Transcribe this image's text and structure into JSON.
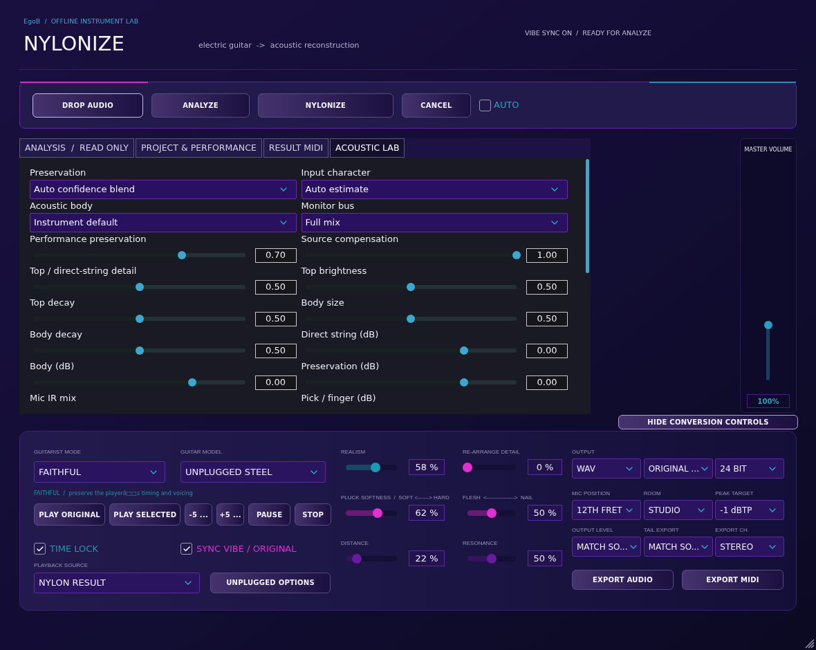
{
  "header": {
    "breadcrumb": "EgoB  /  OFFLINE INSTRUMENT LAB",
    "title": "NYLONIZE",
    "subtitle": "electric guitar  ->  acoustic reconstruction",
    "status": "VIBE SYNC ON  /  READY FOR ANALYZE"
  },
  "toolbar": {
    "buttons": [
      {
        "label": "DROP AUDIO",
        "selected": true
      },
      {
        "label": "ANALYZE",
        "selected": false
      },
      {
        "label": "NYLONIZE",
        "selected": false
      },
      {
        "label": "CANCEL",
        "selected": false
      }
    ],
    "auto": {
      "label": "AUTO",
      "checked": false
    }
  },
  "tabs": [
    {
      "label": "ANALYSIS  /  READ ONLY",
      "selected": false
    },
    {
      "label": "PROJECT & PERFORMANCE",
      "selected": false
    },
    {
      "label": "RESULT MIDI",
      "selected": false
    },
    {
      "label": "ACOUSTIC LAB",
      "selected": true
    }
  ],
  "acoustic_lab": {
    "columns": [
      [
        {
          "kind": "dropdown",
          "label": "Preservation",
          "value": "Auto confidence blend"
        },
        {
          "kind": "dropdown",
          "label": "Acoustic body",
          "value": "Instrument default"
        },
        {
          "kind": "slider",
          "label": "Performance preservation",
          "level": 0.7,
          "reading": "0.70"
        },
        {
          "kind": "slider",
          "label": "Top / direct-string detail",
          "level": 0.5,
          "reading": "0.50"
        },
        {
          "kind": "slider",
          "label": "Top decay",
          "level": 0.5,
          "reading": "0.50"
        },
        {
          "kind": "slider",
          "label": "Body decay",
          "level": 0.5,
          "reading": "0.50"
        },
        {
          "kind": "slider",
          "label": "Body (dB)",
          "level": 0.75,
          "reading": "0.00"
        },
        {
          "kind": "label",
          "label": "Mic IR mix"
        }
      ],
      [
        {
          "kind": "dropdown",
          "label": "Input character",
          "value": "Auto estimate"
        },
        {
          "kind": "dropdown",
          "label": "Monitor bus",
          "value": "Full mix"
        },
        {
          "kind": "slider",
          "label": "Source compensation",
          "level": 1,
          "reading": "1.00"
        },
        {
          "kind": "slider",
          "label": "Top brightness",
          "level": 0.5,
          "reading": "0.50"
        },
        {
          "kind": "slider",
          "label": "Body size",
          "level": 0.5,
          "reading": "0.50"
        },
        {
          "kind": "slider",
          "label": "Direct string (dB)",
          "level": 0.75,
          "reading": "0.00"
        },
        {
          "kind": "slider",
          "label": "Preservation (dB)",
          "level": 0.75,
          "reading": "0.00"
        },
        {
          "kind": "label",
          "label": "Pick / finger (dB)"
        }
      ]
    ]
  },
  "master_volume": {
    "title": "MASTER VOLUME",
    "level": 1,
    "reading": "100%"
  },
  "hide_button": {
    "label": "HIDE CONVERSION CONTROLS"
  },
  "conversion": {
    "modes": [
      {
        "label": "GUITARIST MODE",
        "value": "FAITHFUL"
      },
      {
        "label": "GUITAR MODEL",
        "value": "UNPLUGGED STEEL"
      }
    ],
    "hint": "FAITHFUL  /  preserve the playerâ□□s timing and voicing",
    "transport": [
      "PLAY ORIGINAL",
      "PLAY SELECTED",
      "-5 ...",
      "+5 ...",
      "PAUSE",
      "STOP"
    ],
    "toggles": [
      {
        "label": "TIME LOCK",
        "checked": true,
        "color": "#1a9bb0"
      },
      {
        "label": "SYNC VIBE / ORIGINAL",
        "checked": true,
        "color": "#e030d0"
      }
    ],
    "playback_source": {
      "label": "PLAYBACK SOURCE",
      "value": "NYLON RESULT"
    },
    "options_button": "UNPLUGGED OPTIONS",
    "sliders": [
      {
        "label": "REALISM",
        "level": 0.58,
        "reading": "58 %",
        "color": "#1a9bb0"
      },
      {
        "label": "RE-ARRANGE DETAIL",
        "level": 0,
        "reading": "0 %",
        "color": "#e030d0"
      },
      {
        "label": "PLUCK SOFTNESS  /  SOFT <------> HARD",
        "level": 0.62,
        "reading": "62 %",
        "color": "#e030d0"
      },
      {
        "label": "FLESH  <--------------->  NAIL",
        "level": 0.5,
        "reading": "50 %",
        "color": "#e030d0"
      },
      {
        "label": "DISTANCE",
        "level": 0.22,
        "reading": "22 %",
        "color": "#6a1aa0"
      },
      {
        "label": "RESONANCE",
        "level": 0.5,
        "reading": "50 %",
        "color": "#6a1aa0"
      }
    ],
    "output": [
      {
        "label": "OUTPUT",
        "value": "WAV"
      },
      {
        "value": "ORIGINAL ..."
      },
      {
        "value": "24 BIT"
      },
      {
        "label": "MIC POSITION",
        "value": "12TH FRET"
      },
      {
        "label": "ROOM",
        "value": "STUDIO"
      },
      {
        "label": "PEAK TARGET",
        "value": "-1 dBTP"
      },
      {
        "label": "OUTPUT LEVEL",
        "value": "MATCH SO..."
      },
      {
        "label": "TAIL EXPORT",
        "value": "MATCH SO..."
      },
      {
        "label": "EXPORT CH.",
        "value": "STEREO"
      }
    ],
    "export_buttons": [
      "EXPORT AUDIO",
      "EXPORT MIDI"
    ]
  }
}
